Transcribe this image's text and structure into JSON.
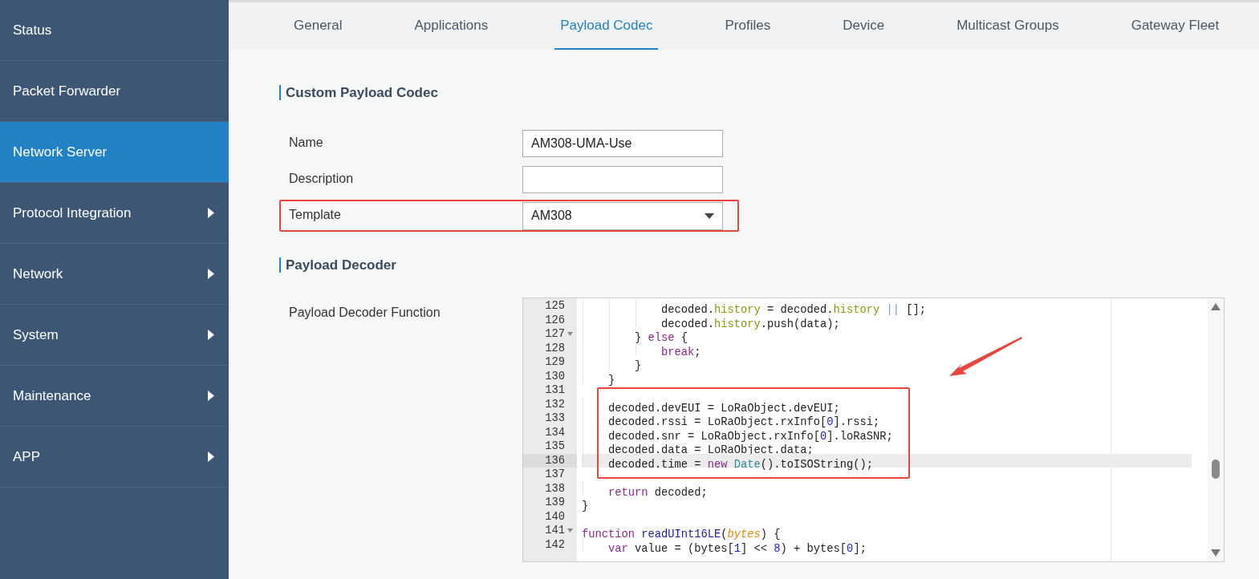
{
  "sidebar": {
    "items": [
      {
        "label": "Status",
        "selected": false,
        "expandable": false
      },
      {
        "label": "Packet Forwarder",
        "selected": false,
        "expandable": false
      },
      {
        "label": "Network Server",
        "selected": true,
        "expandable": false
      },
      {
        "label": "Protocol Integration",
        "selected": false,
        "expandable": true
      },
      {
        "label": "Network",
        "selected": false,
        "expandable": true
      },
      {
        "label": "System",
        "selected": false,
        "expandable": true
      },
      {
        "label": "Maintenance",
        "selected": false,
        "expandable": true
      },
      {
        "label": "APP",
        "selected": false,
        "expandable": true
      }
    ]
  },
  "tabs": [
    {
      "label": "General",
      "selected": false
    },
    {
      "label": "Applications",
      "selected": false
    },
    {
      "label": "Payload Codec",
      "selected": true
    },
    {
      "label": "Profiles",
      "selected": false
    },
    {
      "label": "Device",
      "selected": false
    },
    {
      "label": "Multicast Groups",
      "selected": false
    },
    {
      "label": "Gateway Fleet",
      "selected": false
    }
  ],
  "custom_codec": {
    "title": "Custom Payload Codec",
    "fields": [
      {
        "kind": "text",
        "label": "Name",
        "value": "AM308-UMA-Use"
      },
      {
        "kind": "text",
        "label": "Description"
      },
      {
        "kind": "select",
        "label": "Template",
        "value": "AM308"
      }
    ]
  },
  "decoder": {
    "title": "Payload Decoder",
    "label": "Payload Decoder Function",
    "lines": [
      {
        "number": "125",
        "fold": false,
        "active": false,
        "tokens": [
          {
            "kind": "plain",
            "text": "            decoded."
          },
          {
            "kind": "prop",
            "text": "history"
          },
          {
            "kind": "plain",
            "text": " = decoded."
          },
          {
            "kind": "prop",
            "text": "history"
          },
          {
            "kind": "operator",
            "text": " ||"
          },
          {
            "kind": "plain",
            "text": " [];"
          }
        ]
      },
      {
        "number": "126",
        "fold": false,
        "active": false,
        "tokens": [
          {
            "kind": "plain",
            "text": "            decoded."
          },
          {
            "kind": "prop",
            "text": "history"
          },
          {
            "kind": "plain",
            "text": ".push(data);"
          }
        ]
      },
      {
        "number": "127",
        "fold": true,
        "active": false,
        "tokens": [
          {
            "kind": "plain",
            "text": "        }"
          },
          {
            "kind": "keyword",
            "text": " else"
          },
          {
            "kind": "plain",
            "text": " {"
          }
        ]
      },
      {
        "number": "128",
        "fold": false,
        "active": false,
        "tokens": [
          {
            "kind": "keyword",
            "text": "            break"
          },
          {
            "kind": "plain",
            "text": ";"
          }
        ]
      },
      {
        "number": "129",
        "fold": false,
        "active": false,
        "tokens": [
          {
            "kind": "plain",
            "text": "        }"
          }
        ]
      },
      {
        "number": "130",
        "fold": false,
        "active": false,
        "tokens": [
          {
            "kind": "plain",
            "text": "    }"
          }
        ]
      },
      {
        "number": "131",
        "fold": false,
        "active": false
      },
      {
        "number": "132",
        "fold": false,
        "active": false,
        "tokens": [
          {
            "kind": "plain",
            "text": "    decoded.devEUI = LoRaObject.devEUI;"
          }
        ]
      },
      {
        "number": "133",
        "fold": false,
        "active": false,
        "tokens": [
          {
            "kind": "plain",
            "text": "    decoded.rssi = LoRaObject.rxInfo["
          },
          {
            "kind": "number",
            "text": "0"
          },
          {
            "kind": "plain",
            "text": "].rssi;"
          }
        ]
      },
      {
        "number": "134",
        "fold": false,
        "active": false,
        "tokens": [
          {
            "kind": "plain",
            "text": "    decoded.snr = LoRaObject.rxInfo["
          },
          {
            "kind": "number",
            "text": "0"
          },
          {
            "kind": "plain",
            "text": "].loRaSNR;"
          }
        ]
      },
      {
        "number": "135",
        "fold": false,
        "active": false,
        "tokens": [
          {
            "kind": "plain",
            "text": "    decoded.data = LoRaObject.data;"
          }
        ]
      },
      {
        "number": "136",
        "fold": false,
        "active": true,
        "tokens": [
          {
            "kind": "plain",
            "text": "    decoded.time ="
          },
          {
            "kind": "keyword",
            "text": " new"
          },
          {
            "kind": "type",
            "text": " Date"
          },
          {
            "kind": "plain",
            "text": "().toISOString();"
          }
        ]
      },
      {
        "number": "137",
        "fold": false,
        "active": false
      },
      {
        "number": "138",
        "fold": false,
        "active": false,
        "tokens": [
          {
            "kind": "keyword",
            "text": "    return"
          },
          {
            "kind": "plain",
            "text": " decoded;"
          }
        ]
      },
      {
        "number": "139",
        "fold": false,
        "active": false,
        "tokens": [
          {
            "kind": "plain",
            "text": "}"
          }
        ]
      },
      {
        "number": "140",
        "fold": false,
        "active": false
      },
      {
        "number": "141",
        "fold": true,
        "active": false,
        "tokens": [
          {
            "kind": "keyword",
            "text": "function"
          },
          {
            "kind": "fn",
            "text": " readUInt16LE"
          },
          {
            "kind": "plain",
            "text": "("
          },
          {
            "kind": "param",
            "text": "bytes"
          },
          {
            "kind": "plain",
            "text": ") {"
          }
        ]
      },
      {
        "number": "142",
        "fold": false,
        "active": false,
        "tokens": [
          {
            "kind": "keyword",
            "text": "    var"
          },
          {
            "kind": "plain",
            "text": " value = (bytes["
          },
          {
            "kind": "number",
            "text": "1"
          },
          {
            "kind": "plain",
            "text": "] <<"
          },
          {
            "kind": "number",
            "text": " 8"
          },
          {
            "kind": "plain",
            "text": ") + bytes["
          },
          {
            "kind": "number",
            "text": "0"
          },
          {
            "kind": "plain",
            "text": "];"
          }
        ]
      }
    ]
  }
}
